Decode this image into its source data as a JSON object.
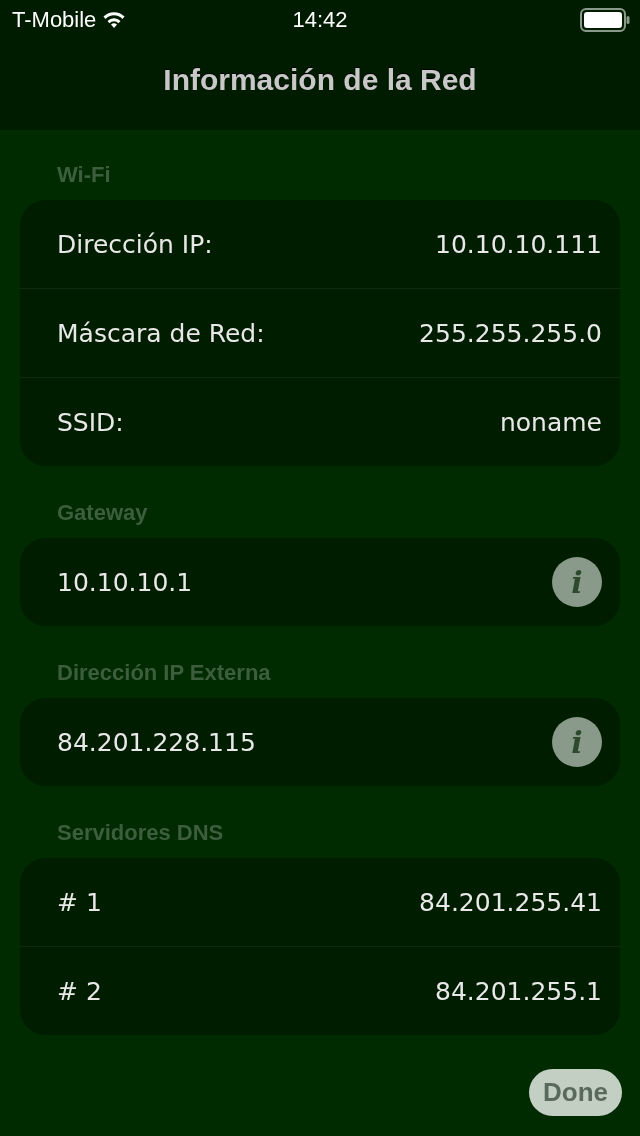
{
  "status_bar": {
    "carrier": "T-Mobile",
    "time": "14:42"
  },
  "nav": {
    "title": "Información de la Red"
  },
  "sections": [
    {
      "header": "Wi-Fi",
      "kind": "pairs",
      "rows": [
        {
          "label": "Dirección IP:",
          "value": "10.10.10.111"
        },
        {
          "label": "Máscara de Red:",
          "value": "255.255.255.0"
        },
        {
          "label": "SSID:",
          "value": "noname"
        }
      ]
    },
    {
      "header": "Gateway",
      "kind": "single",
      "rows": [
        {
          "value": "10.10.10.1",
          "info": "i"
        }
      ]
    },
    {
      "header": "Dirección IP Externa",
      "kind": "single",
      "rows": [
        {
          "value": "84.201.228.115",
          "info": "i"
        }
      ]
    },
    {
      "header": "Servidores DNS",
      "kind": "pairs",
      "rows": [
        {
          "label": "# 1",
          "value": "84.201.255.41"
        },
        {
          "label": "# 2",
          "value": "84.201.255.1"
        }
      ]
    }
  ],
  "done_button": "Done"
}
